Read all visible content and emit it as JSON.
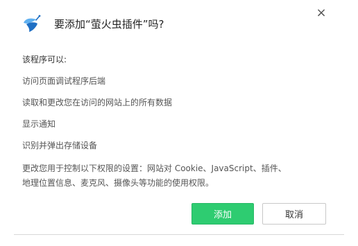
{
  "dialog": {
    "title": "要添加“萤火虫插件”吗?",
    "close_glyph": "×",
    "icon_name": "firefly-extension-icon"
  },
  "permissions": {
    "heading": "该程序可以:",
    "items": [
      "访问页面调试程序后端",
      "读取和更改您在访问的网站上的所有数据",
      "显示通知",
      "识别并弹出存储设备"
    ],
    "note": "更改您用于控制以下权限的设置：网站对 Cookie、JavaScript、插件、\n地理位置信息、麦克风、摄像头等功能的使用权限。"
  },
  "buttons": {
    "add_label": "添加",
    "cancel_label": "取消"
  },
  "colors": {
    "accent": "#2ecc71",
    "icon_blue": "#3a8dde"
  }
}
